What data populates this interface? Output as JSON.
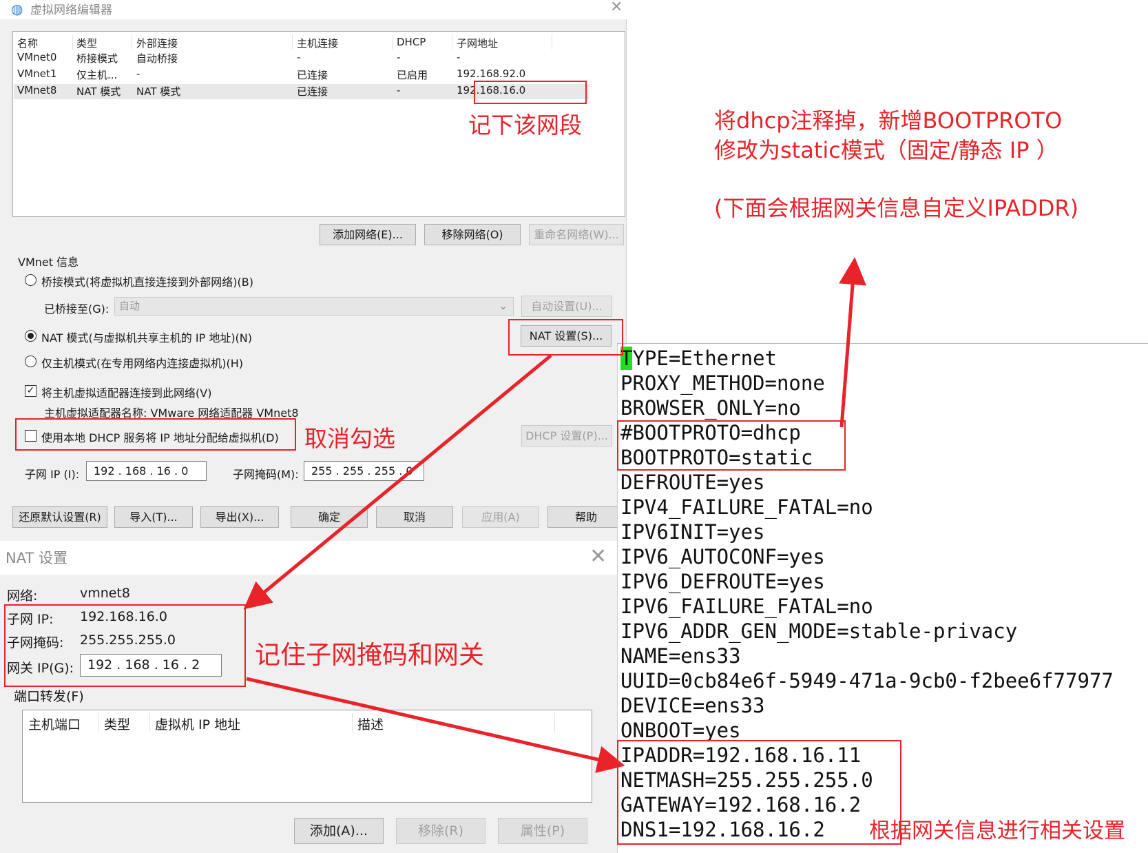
{
  "editor": {
    "title": "虚拟网络编辑器",
    "close": "✕",
    "columns": [
      "名称",
      "类型",
      "外部连接",
      "主机连接",
      "DHCP",
      "子网地址"
    ],
    "rows": [
      [
        "VMnet0",
        "桥接模式",
        "自动桥接",
        "-",
        "-",
        "-"
      ],
      [
        "VMnet1",
        "仅主机...",
        "-",
        "已连接",
        "已启用",
        "192.168.92.0"
      ],
      [
        "VMnet8",
        "NAT 模式",
        "NAT 模式",
        "已连接",
        "-",
        "192.168.16.0"
      ]
    ],
    "btn_add_network": "添加网络(E)...",
    "btn_remove_network": "移除网络(O)",
    "btn_rename_network": "重命名网络(W)...",
    "vmnet_info_label": "VMnet 信息",
    "radio_bridge": "桥接模式(将虚拟机直接连接到外部网络)(B)",
    "bridged_to_label": "已桥接至(G):",
    "bridged_to_value": "自动",
    "btn_auto_settings": "自动设置(U)...",
    "radio_nat": "NAT 模式(与虚拟机共享主机的 IP 地址)(N)",
    "btn_nat_settings": "NAT 设置(S)...",
    "radio_hostonly": "仅主机模式(在专用网络内连接虚拟机)(H)",
    "check_host_adapter": "将主机虚拟适配器连接到此网络(V)",
    "host_adapter_name": "主机虚拟适配器名称: VMware 网络适配器 VMnet8",
    "check_dhcp": "使用本地 DHCP 服务将 IP 地址分配给虚拟机(D)",
    "btn_dhcp_settings": "DHCP 设置(P)...",
    "subnet_ip_label": "子网 IP (I):",
    "subnet_ip_value": "192 . 168 . 16  .  0",
    "subnet_mask_label": "子网掩码(M):",
    "subnet_mask_value": "255 . 255 . 255 .  0",
    "btn_restore": "还原默认设置(R)",
    "btn_import": "导入(T)...",
    "btn_export": "导出(X)...",
    "btn_ok": "确定",
    "btn_cancel": "取消",
    "btn_apply": "应用(A)",
    "btn_help": "帮助"
  },
  "nat": {
    "title": "NAT 设置",
    "close": "✕",
    "network_label": "网络:",
    "network_value": "vmnet8",
    "subnet_ip_label": "子网 IP:",
    "subnet_ip_value": "192.168.16.0",
    "subnet_mask_label": "子网掩码:",
    "subnet_mask_value": "255.255.255.0",
    "gateway_label": "网关 IP(G):",
    "gateway_value": "192 . 168 . 16  .  2",
    "port_forward_label": "端口转发(F)",
    "port_columns": [
      "主机端口",
      "类型",
      "虚拟机 IP 地址",
      "描述"
    ],
    "btn_add": "添加(A)...",
    "btn_remove": "移除(R)",
    "btn_props": "属性(P)"
  },
  "config": {
    "first_char": "T",
    "first_rest": "YPE=Ethernet",
    "lines": [
      "PROXY_METHOD=none",
      "BROWSER_ONLY=no",
      "#BOOTPROTO=dhcp",
      "BOOTPROTO=static",
      "DEFROUTE=yes",
      "IPV4_FAILURE_FATAL=no",
      "IPV6INIT=yes",
      "IPV6_AUTOCONF=yes",
      "IPV6_DEFROUTE=yes",
      "IPV6_FAILURE_FATAL=no",
      "IPV6_ADDR_GEN_MODE=stable-privacy",
      "NAME=ens33",
      "UUID=0cb84e6f-5949-471a-9cb0-f2bee6f77977",
      "DEVICE=ens33",
      "ONBOOT=yes",
      "IPADDR=192.168.16.11",
      "NETMASH=255.255.255.0",
      "GATEWAY=192.168.16.2",
      "DNS1=192.168.16.2"
    ]
  },
  "annotations": {
    "note_subnet": "记下该网段",
    "note_uncheck": "取消勾选",
    "note_remember": "记住子网掩码和网关",
    "note_bootproto_1": "将dhcp注释掉，新增BOOTPROTO",
    "note_bootproto_2": "修改为static模式（固定/静态 IP ）",
    "note_ipaddr": "(下面会根据网关信息自定义IPADDR)",
    "note_gateway_setup": "根据网关信息进行相关设置",
    "color": "#e8232a"
  },
  "colors": {
    "dialog_bg": "#f0f0f0",
    "cursor_highlight": "#1fe01f",
    "accent_red": "#e8232a"
  }
}
